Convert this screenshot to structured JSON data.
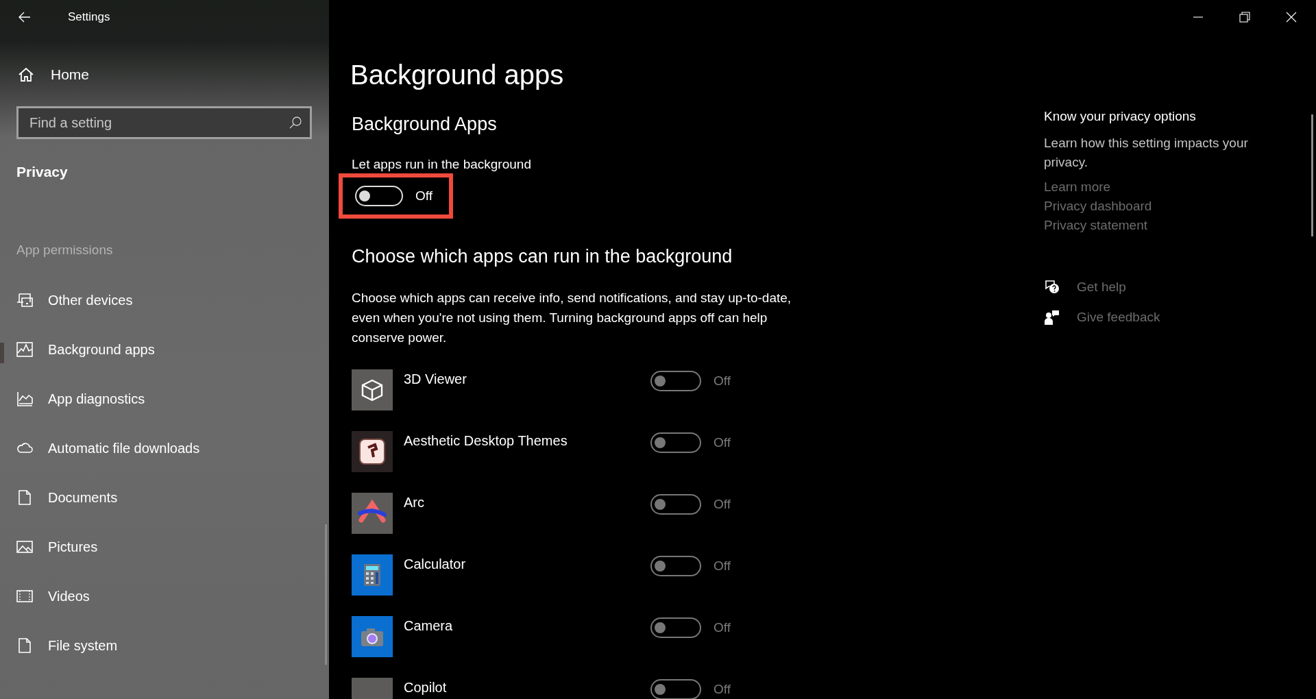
{
  "window": {
    "title": "Settings"
  },
  "sidebar": {
    "home": "Home",
    "search": {
      "placeholder": "Find a setting"
    },
    "section": "Privacy",
    "group": "App permissions",
    "items": [
      {
        "label": "Other devices",
        "selected": false
      },
      {
        "label": "Background apps",
        "selected": true
      },
      {
        "label": "App diagnostics",
        "selected": false
      },
      {
        "label": "Automatic file downloads",
        "selected": false
      },
      {
        "label": "Documents",
        "selected": false
      },
      {
        "label": "Pictures",
        "selected": false
      },
      {
        "label": "Videos",
        "selected": false
      },
      {
        "label": "File system",
        "selected": false
      }
    ]
  },
  "main": {
    "title": "Background apps",
    "section_title": "Background Apps",
    "master": {
      "label": "Let apps run in the background",
      "on": false,
      "state_text": "Off",
      "highlighted": true
    },
    "list_title": "Choose which apps can run in the background",
    "description": "Choose which apps can receive info, send notifications, and stay up-to-date, even when you're not using them. Turning background apps off can help conserve power.",
    "apps": [
      {
        "name": "3D Viewer",
        "on": false,
        "state_text": "Off"
      },
      {
        "name": "Aesthetic Desktop Themes",
        "on": false,
        "state_text": "Off"
      },
      {
        "name": "Arc",
        "on": false,
        "state_text": "Off"
      },
      {
        "name": "Calculator",
        "on": false,
        "state_text": "Off"
      },
      {
        "name": "Camera",
        "on": false,
        "state_text": "Off"
      },
      {
        "name": "Copilot",
        "on": false,
        "state_text": "Off"
      }
    ]
  },
  "aside": {
    "title": "Know your privacy options",
    "text": "Learn how this setting impacts your privacy.",
    "links": [
      "Learn more",
      "Privacy dashboard",
      "Privacy statement"
    ],
    "help": [
      "Get help",
      "Give feedback"
    ]
  }
}
